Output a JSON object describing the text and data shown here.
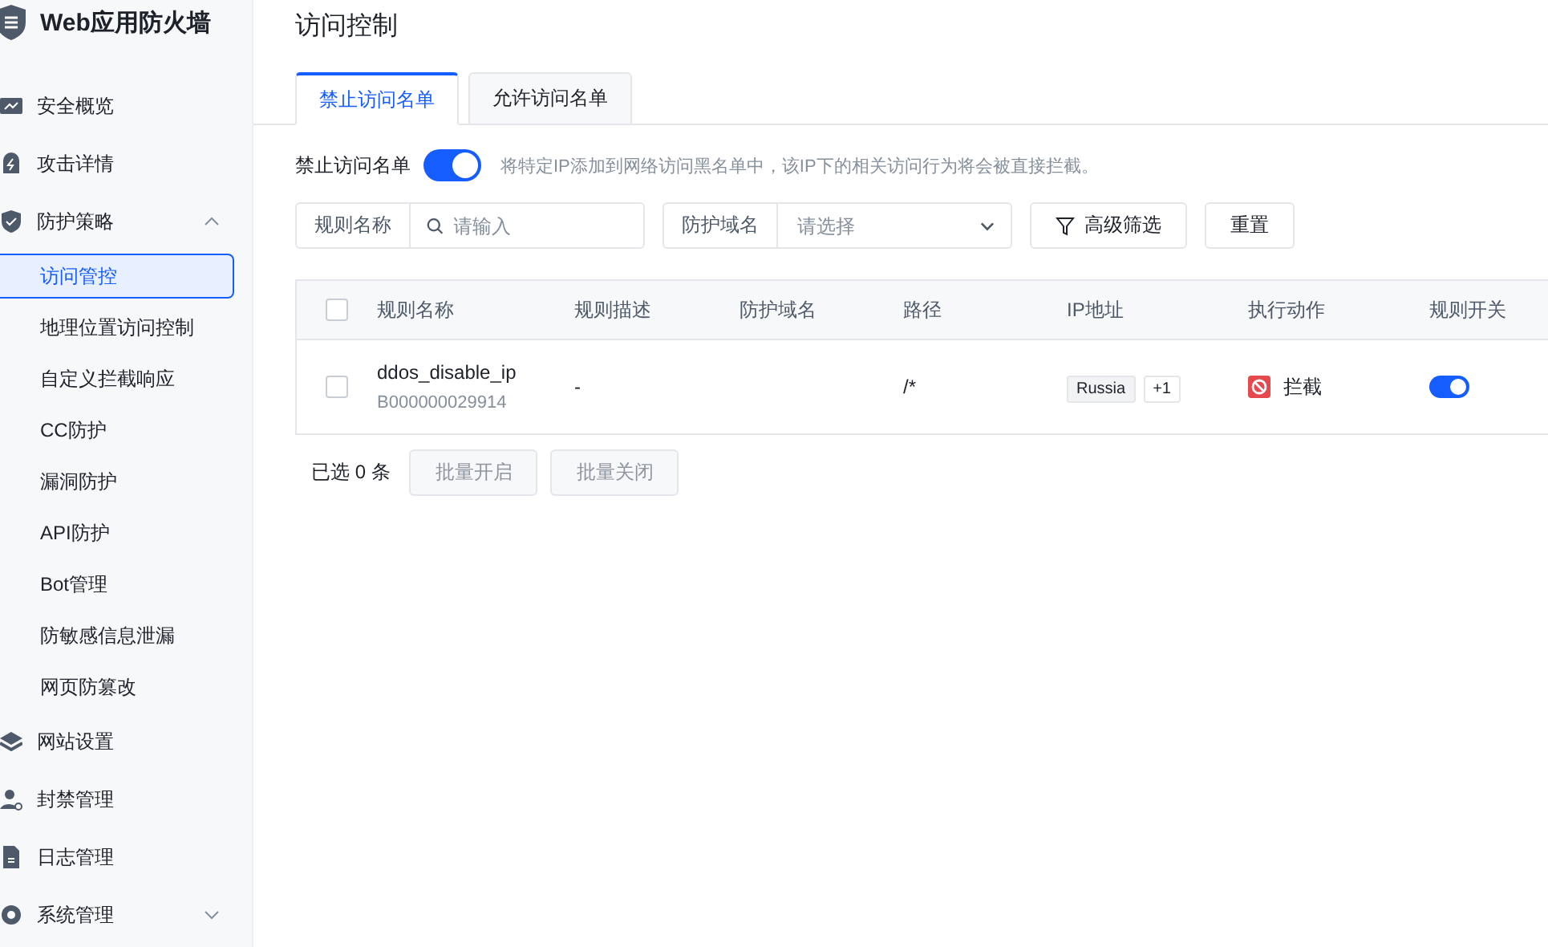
{
  "app": {
    "title": "Web应用防火墙"
  },
  "sidebar": {
    "items": [
      {
        "label": "安全概览"
      },
      {
        "label": "攻击详情"
      },
      {
        "label": "防护策略",
        "expanded": true,
        "children": [
          {
            "label": "访问管控",
            "selected": true
          },
          {
            "label": "地理位置访问控制",
            "selected": false
          },
          {
            "label": "自定义拦截响应",
            "selected": false
          },
          {
            "label": "CC防护",
            "selected": false
          },
          {
            "label": "漏洞防护",
            "selected": false
          },
          {
            "label": "API防护",
            "selected": false
          },
          {
            "label": "Bot管理",
            "selected": false
          },
          {
            "label": "防敏感信息泄漏",
            "selected": false
          },
          {
            "label": "网页防篡改",
            "selected": false
          }
        ]
      },
      {
        "label": "网站设置"
      },
      {
        "label": "封禁管理"
      },
      {
        "label": "日志管理"
      },
      {
        "label": "系统管理",
        "expanded": false
      }
    ]
  },
  "page": {
    "title": "访问控制"
  },
  "tabs": [
    {
      "label": "禁止访问名单",
      "selected": true
    },
    {
      "label": "允许访问名单",
      "selected": false
    }
  ],
  "blacklist": {
    "label": "禁止访问名单",
    "on": true,
    "description": "将特定IP添加到网络访问黑名单中，该IP下的相关访问行为将会被直接拦截。"
  },
  "filters": {
    "name": {
      "label": "规则名称",
      "placeholder": "请输入"
    },
    "domain": {
      "label": "防护域名",
      "placeholder": "请选择"
    },
    "advanced": "高级筛选",
    "reset": "重置"
  },
  "table": {
    "select_all": {
      "checked": false
    },
    "columns": [
      "规则名称",
      "规则描述",
      "防护域名",
      "路径",
      "IP地址",
      "执行动作",
      "规则开关"
    ],
    "rows": [
      {
        "checked": false,
        "name": "ddos_disable_ip",
        "id": "B000000029914",
        "description": "-",
        "path": "/*",
        "ips": [
          "Russia",
          "+1"
        ],
        "action": "拦截",
        "on": true
      }
    ]
  },
  "footer": {
    "selected": "已选 0 条",
    "buttons": [
      {
        "label": "批量开启",
        "disabled": true
      },
      {
        "label": "批量关闭",
        "disabled": true
      }
    ]
  }
}
